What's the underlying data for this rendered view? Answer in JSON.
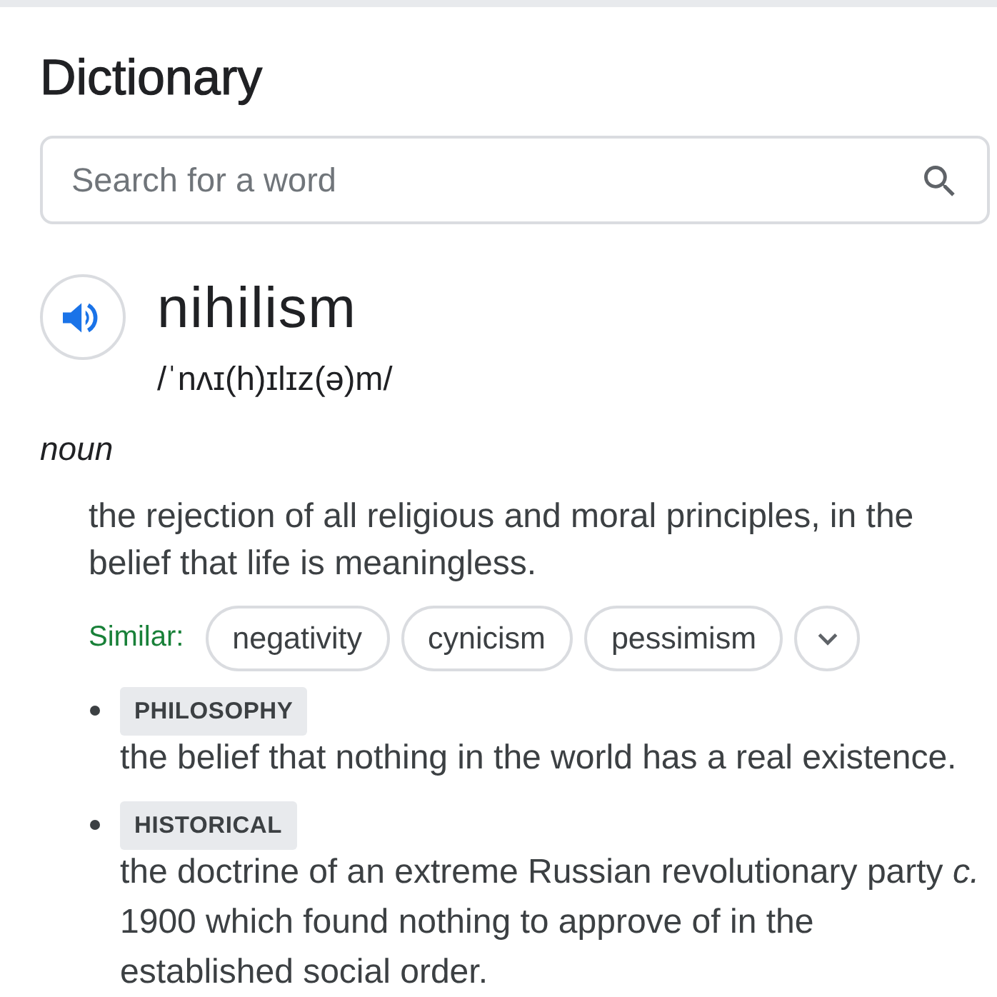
{
  "header": {
    "title": "Dictionary"
  },
  "search": {
    "placeholder": "Search for a word"
  },
  "entry": {
    "word": "nihilism",
    "phonetic": "/ˈnʌɪ(h)ɪlɪz(ə)m/",
    "part_of_speech": "noun",
    "definition": "the rejection of all religious and moral principles, in the belief that life is meaningless.",
    "similar": {
      "label": "Similar:",
      "words": [
        "negativity",
        "cynicism",
        "pessimism"
      ]
    },
    "senses": [
      {
        "label": "PHILOSOPHY",
        "definition": "the belief that nothing in the world has a real existence."
      },
      {
        "label": "HISTORICAL",
        "definition": "the doctrine of an extreme Russian revolutionary party *c.* 1900 which found nothing to approve of in the established social order."
      }
    ]
  }
}
